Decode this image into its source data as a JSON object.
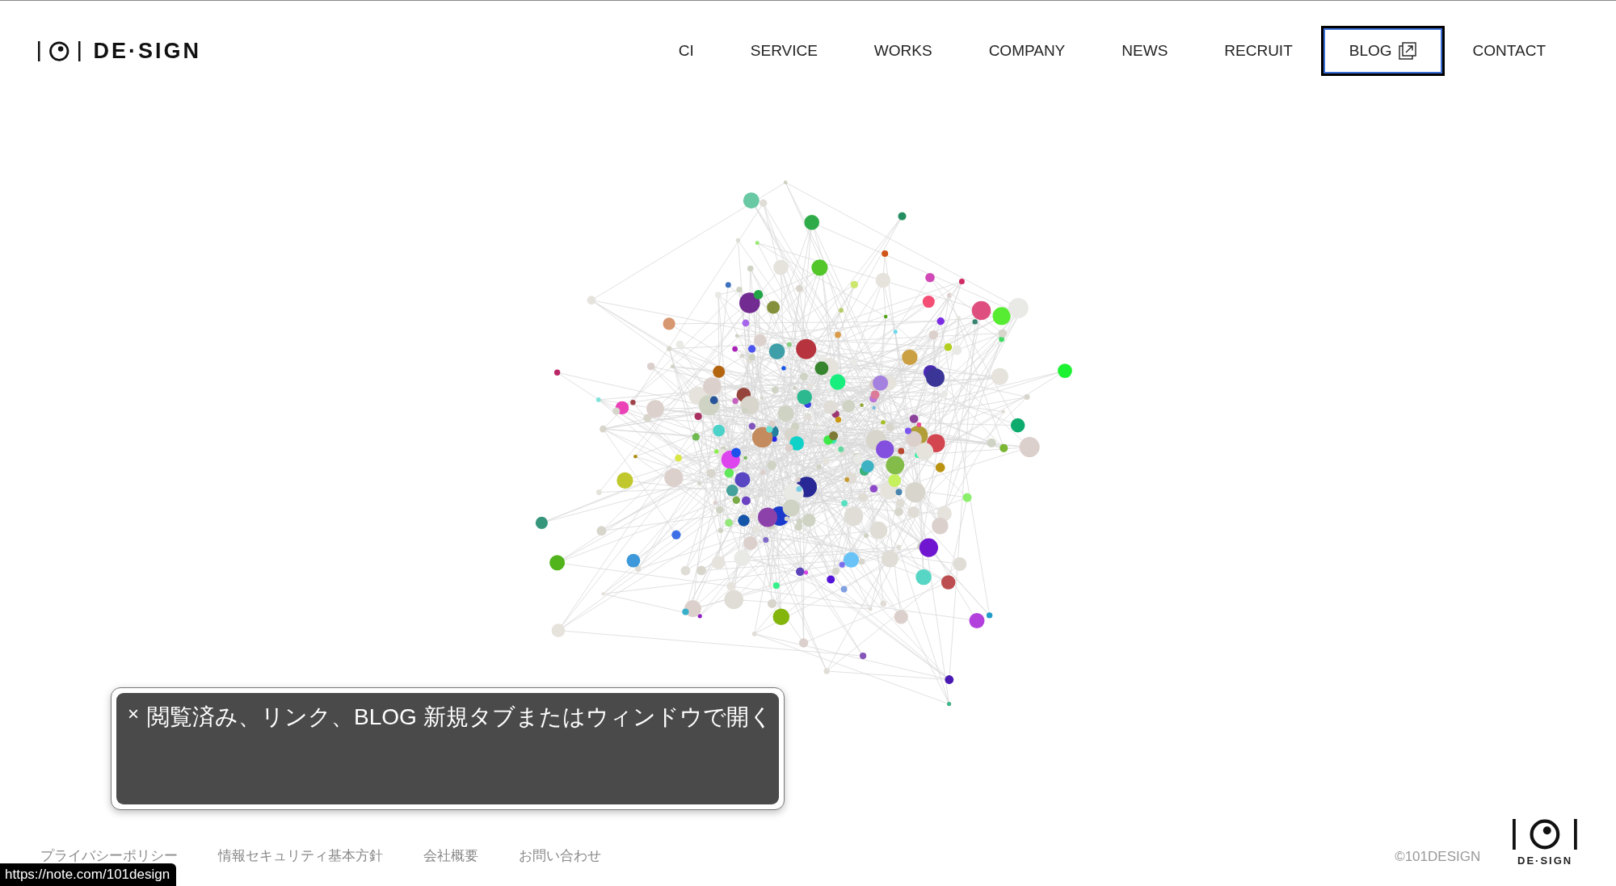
{
  "header": {
    "logo": {
      "text": "DE·SIGN"
    },
    "nav": [
      {
        "label": "CI",
        "focused": false,
        "external": false
      },
      {
        "label": "SERVICE",
        "focused": false,
        "external": false
      },
      {
        "label": "WORKS",
        "focused": false,
        "external": false
      },
      {
        "label": "COMPANY",
        "focused": false,
        "external": false
      },
      {
        "label": "NEWS",
        "focused": false,
        "external": false
      },
      {
        "label": "RECRUIT",
        "focused": false,
        "external": false
      },
      {
        "label": "BLOG",
        "focused": true,
        "external": true
      },
      {
        "label": "CONTACT",
        "focused": false,
        "external": false
      }
    ]
  },
  "tooltip": {
    "close": "×",
    "text": "閲覧済み、リンク、BLOG 新規タブまたはウィンドウで開く"
  },
  "footer": {
    "links": [
      "プライバシーポリシー",
      "情報セキュリティ基本方針",
      "会社概要",
      "お問い合わせ"
    ],
    "copyright": "©101DESIGN",
    "logo": {
      "text": "DE·SIGN"
    }
  },
  "status_bar": {
    "url": "https://note.com/101design"
  }
}
